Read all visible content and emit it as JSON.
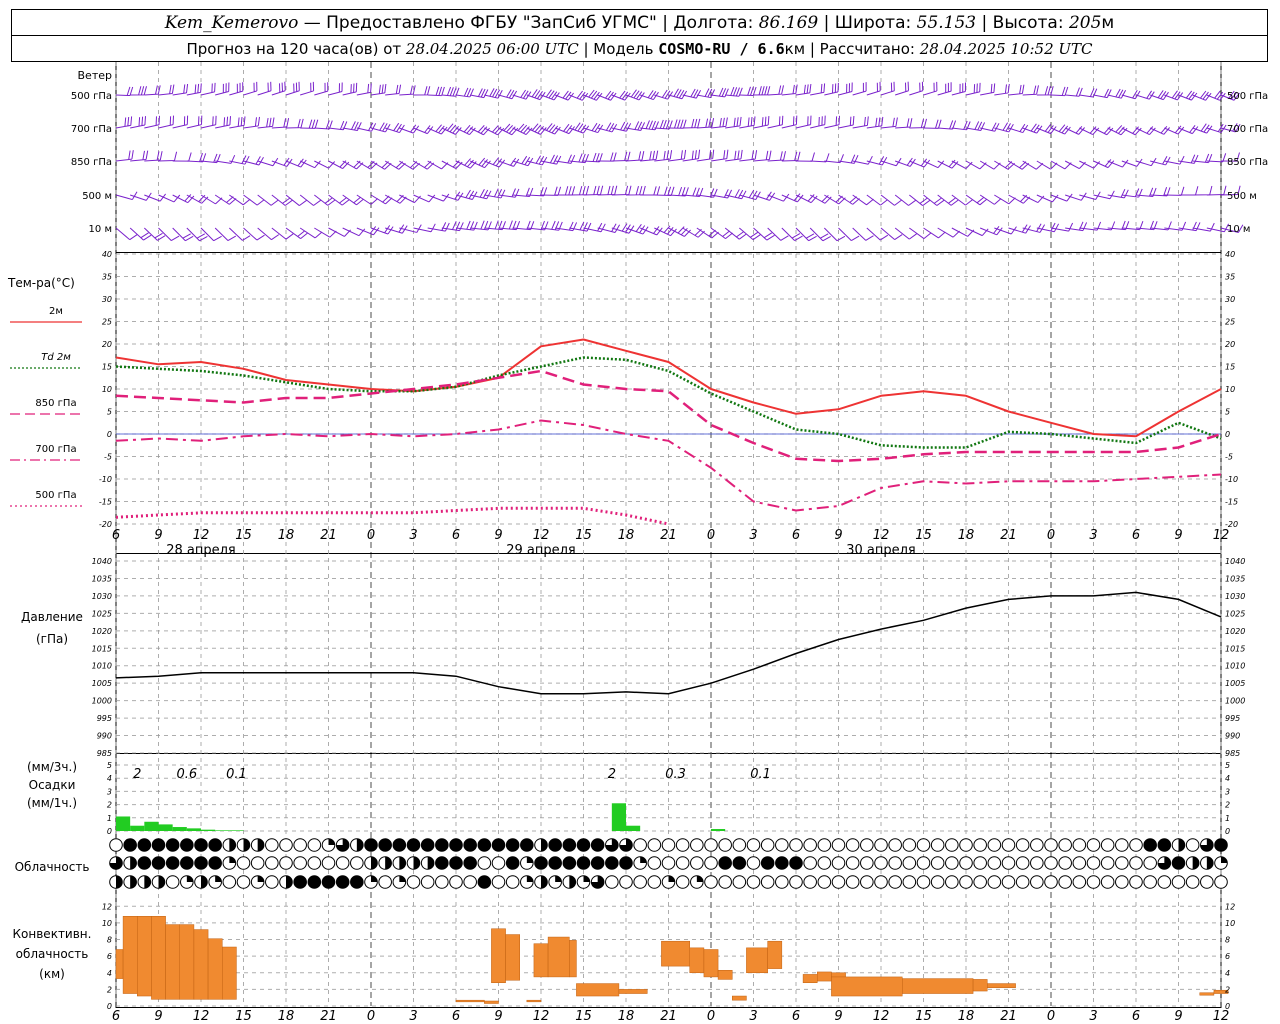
{
  "header": {
    "station": "Kem_Kemerovo",
    "provided_prefix": "—  Предоставлено ФГБУ \"ЗапСиб УГМС\"",
    "lon_label": "Долгота:",
    "lon": "86.169",
    "lat_label": "Широта:",
    "lat": "55.153",
    "alt_label": "Высота:",
    "alt": "205",
    "alt_unit": "м",
    "forecast_label": "Прогноз на 120 часа(ов) от",
    "forecast_time": "28.04.2025 06:00 UTC",
    "model_label": "Модель",
    "model": "COSMO-RU / 6.6",
    "model_unit": "км",
    "calc_label": "Рассчитано:",
    "calc_time": "28.04.2025 10:52 UTC"
  },
  "wind_panel": {
    "title": "Ветер",
    "levels": [
      "500 гПа",
      "700 гПа",
      "850 гПа",
      "500 м",
      "10  м"
    ],
    "barb_color": "#7a22cc"
  },
  "time_axis": {
    "hour_labels": [
      "6",
      "9",
      "12",
      "15",
      "18",
      "21",
      "0",
      "3",
      "6",
      "9",
      "12",
      "15",
      "18",
      "21",
      "0",
      "3",
      "6",
      "9",
      "12",
      "15",
      "18",
      "21",
      "0",
      "3",
      "6",
      "9",
      "12"
    ],
    "dates": [
      "28 апреля",
      "29 апреля",
      "30 апреля"
    ]
  },
  "temp_legend": {
    "title": "Тем-ра(°C)",
    "items": [
      {
        "label": "2м",
        "color": "#ee3333",
        "style": "solid"
      },
      {
        "label": "Td 2м",
        "color": "#117711",
        "style": "dotted"
      },
      {
        "label": "850 гПа",
        "color": "#e0207a",
        "style": "dash"
      },
      {
        "label": "700 гПа",
        "color": "#e0207a",
        "style": "dashdot"
      },
      {
        "label": "500 гПа",
        "color": "#e0207a",
        "style": "dot"
      }
    ]
  },
  "pressure_labels": {
    "title": "Давление",
    "unit": "(гПа)"
  },
  "precip_labels": {
    "unit3": "(мм/3ч.)",
    "title": "Осадки",
    "unit1": "(мм/1ч.)",
    "amounts": [
      "2",
      "0.6",
      "0.1",
      "2",
      "0.3",
      "0.1"
    ]
  },
  "cloud_labels": {
    "title": "Облачность"
  },
  "conv_labels": {
    "line1": "Конвективн.",
    "line2": "облачность",
    "line3": "(км)"
  },
  "colors": {
    "temp2m": "#ee3333",
    "dew": "#117711",
    "upper": "#e0207a",
    "pressure": "#000000",
    "precip": "#22cc22",
    "convective": "#f08a30",
    "grid": "#999999"
  },
  "chart_data": [
    {
      "type": "line",
      "title": "Тем-ра(°C)",
      "x_hours": [
        0,
        3,
        6,
        9,
        12,
        15,
        18,
        21,
        24,
        27,
        30,
        33,
        36,
        39,
        42,
        45,
        48,
        51,
        54,
        57,
        60,
        63,
        66,
        69,
        72,
        75,
        78
      ],
      "ylim": [
        -20,
        40
      ],
      "series": [
        {
          "name": "2м",
          "values": [
            17,
            15.5,
            16,
            14.5,
            12,
            11,
            10,
            9.5,
            10.5,
            12.5,
            19.5,
            21,
            18.5,
            16,
            10,
            7,
            4.5,
            5.5,
            8.5,
            9.5,
            8.5,
            5,
            2.5,
            0,
            -0.5,
            5,
            10
          ]
        },
        {
          "name": "Td 2м",
          "values": [
            15,
            14.5,
            14,
            13,
            11.5,
            10,
            9.5,
            9.5,
            10.5,
            13,
            15,
            17,
            16.5,
            14,
            9,
            5,
            1,
            0,
            -2.5,
            -3,
            -3,
            0.5,
            0,
            -1,
            -2,
            2.5,
            -1
          ]
        },
        {
          "name": "850 гПа",
          "values": [
            8.5,
            8,
            7.5,
            7,
            8,
            8,
            9,
            10,
            11,
            12.5,
            14,
            11,
            10,
            9.5,
            2,
            -2,
            -5.5,
            -6,
            -5.5,
            -4.5,
            -4,
            -4,
            -4,
            -4,
            -4,
            -3,
            0
          ]
        },
        {
          "name": "700 гПа",
          "values": [
            -1.5,
            -1,
            -1.5,
            -0.5,
            0,
            -0.5,
            0,
            -0.5,
            0,
            1,
            3,
            2,
            0,
            -1.5,
            -7.5,
            -15,
            -17,
            -16,
            -12,
            -10.5,
            -11,
            -10.5,
            -10.5,
            -10.5,
            -10,
            -9.5,
            -9
          ]
        },
        {
          "name": "500 гПа",
          "values": [
            -18.5,
            -18,
            -17.5,
            -17.5,
            -17.5,
            -17.5,
            -17.5,
            -17.5,
            -17,
            -16.5,
            -16.5,
            -16.5,
            -18,
            -20
          ]
        }
      ]
    },
    {
      "type": "line",
      "title": "Давление",
      "ylabel": "(гПа)",
      "ylim": [
        985,
        1040
      ],
      "x_hours": [
        0,
        3,
        6,
        9,
        12,
        15,
        18,
        21,
        24,
        27,
        30,
        33,
        36,
        39,
        42,
        45,
        48,
        51,
        54,
        57,
        60,
        63,
        66,
        69,
        72,
        75,
        78
      ],
      "values": [
        1006.5,
        1007,
        1008,
        1008,
        1008,
        1008,
        1008,
        1008,
        1007,
        1004,
        1002,
        1002,
        1002.5,
        1002,
        1005,
        1009,
        1013.5,
        1017.5,
        1020.5,
        1023,
        1026.5,
        1029,
        1030,
        1030,
        1031,
        1029,
        1024
      ]
    },
    {
      "type": "bar",
      "title": "Осадки",
      "ylabel": "(мм/1ч.)",
      "ylim": [
        0,
        5
      ],
      "x_hours": [
        0,
        1,
        2,
        3,
        4,
        5,
        6,
        7,
        8,
        35,
        36,
        42
      ],
      "values": [
        1.1,
        0.4,
        0.7,
        0.5,
        0.3,
        0.2,
        0.1,
        0.05,
        0.05,
        2.1,
        0.4,
        0.15
      ]
    },
    {
      "type": "bar",
      "title": "Конвективн. облачность",
      "ylabel": "(км)",
      "ylim": [
        0,
        13
      ],
      "bars": [
        {
          "start": 0,
          "end": 0.5,
          "base": 3.3,
          "top": 6.8
        },
        {
          "start": 0.5,
          "end": 1.5,
          "base": 1.5,
          "top": 10.8
        },
        {
          "start": 1.5,
          "end": 2.5,
          "base": 1.2,
          "top": 10.8
        },
        {
          "start": 2.5,
          "end": 3.5,
          "base": 0.8,
          "top": 10.8
        },
        {
          "start": 3.5,
          "end": 4.5,
          "base": 0.8,
          "top": 9.8
        },
        {
          "start": 4.5,
          "end": 5.5,
          "base": 0.8,
          "top": 9.8
        },
        {
          "start": 5.5,
          "end": 6.5,
          "base": 0.8,
          "top": 9.2
        },
        {
          "start": 6.5,
          "end": 7.5,
          "base": 0.8,
          "top": 8.1
        },
        {
          "start": 7.5,
          "end": 8.5,
          "base": 0.8,
          "top": 7.1
        },
        {
          "start": 24,
          "end": 26,
          "base": 0.5,
          "top": 0.7
        },
        {
          "start": 26,
          "end": 27,
          "base": 0.3,
          "top": 0.6
        },
        {
          "start": 26.5,
          "end": 27.5,
          "base": 2.8,
          "top": 9.3
        },
        {
          "start": 27.5,
          "end": 28.5,
          "base": 3.1,
          "top": 8.6
        },
        {
          "start": 29,
          "end": 30,
          "base": 0.5,
          "top": 0.7
        },
        {
          "start": 29.5,
          "end": 30.5,
          "base": 3.5,
          "top": 7.5
        },
        {
          "start": 30.5,
          "end": 32,
          "base": 3.5,
          "top": 8.3
        },
        {
          "start": 32,
          "end": 32.5,
          "base": 3.5,
          "top": 7.9
        },
        {
          "start": 32.5,
          "end": 35.5,
          "base": 1.2,
          "top": 2.7
        },
        {
          "start": 35.5,
          "end": 37.5,
          "base": 1.5,
          "top": 2.0
        },
        {
          "start": 38.5,
          "end": 40.5,
          "base": 4.8,
          "top": 7.8
        },
        {
          "start": 40.5,
          "end": 41.5,
          "base": 4.0,
          "top": 7.0
        },
        {
          "start": 41.5,
          "end": 42.5,
          "base": 3.5,
          "top": 6.8
        },
        {
          "start": 42.5,
          "end": 43.5,
          "base": 3.2,
          "top": 4.3
        },
        {
          "start": 43.5,
          "end": 44.5,
          "base": 0.7,
          "top": 1.2
        },
        {
          "start": 44.5,
          "end": 46,
          "base": 4.0,
          "top": 7.0
        },
        {
          "start": 46,
          "end": 47,
          "base": 4.5,
          "top": 7.8
        },
        {
          "start": 48.5,
          "end": 49.5,
          "base": 2.8,
          "top": 3.8
        },
        {
          "start": 49.5,
          "end": 50.5,
          "base": 3.0,
          "top": 4.1
        },
        {
          "start": 50.5,
          "end": 51.5,
          "base": 3.3,
          "top": 4.0
        },
        {
          "start": 50.5,
          "end": 55.5,
          "base": 1.2,
          "top": 3.5
        },
        {
          "start": 55.5,
          "end": 60.5,
          "base": 1.5,
          "top": 3.3
        },
        {
          "start": 60.5,
          "end": 61.5,
          "base": 1.8,
          "top": 3.2
        },
        {
          "start": 61.5,
          "end": 63.5,
          "base": 2.2,
          "top": 2.7
        },
        {
          "start": 76.5,
          "end": 77.5,
          "base": 1.3,
          "top": 1.6
        },
        {
          "start": 77.5,
          "end": 78.5,
          "base": 1.5,
          "top": 1.9
        }
      ]
    }
  ]
}
